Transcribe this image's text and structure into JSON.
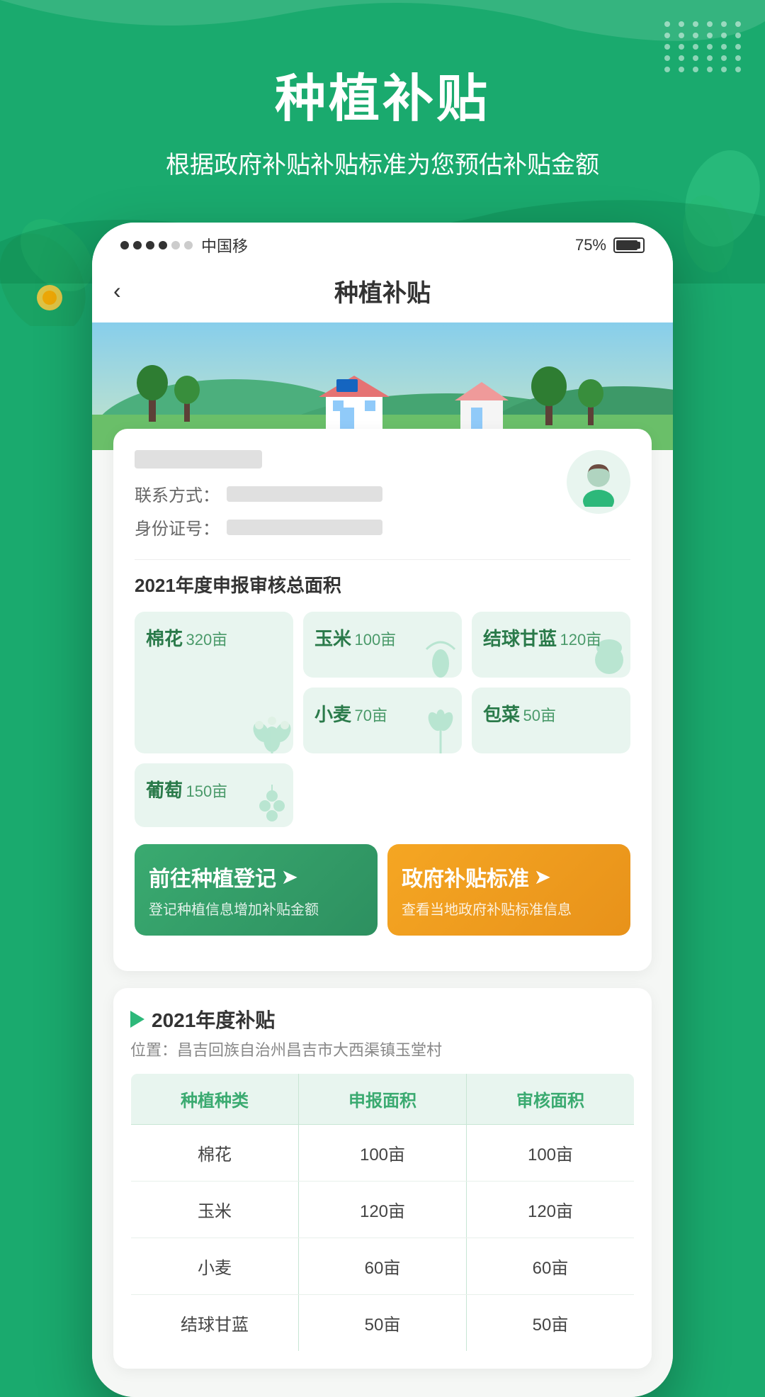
{
  "app": {
    "title": "种植补贴",
    "subtitle": "根据政府补贴补贴标准为您预估补贴金额",
    "status_bar": {
      "carrier": "中国移",
      "battery_percent": "75%",
      "dots": [
        "filled",
        "filled",
        "filled",
        "filled",
        "empty",
        "empty"
      ]
    },
    "back_label": "‹",
    "nav_title": "种植补贴"
  },
  "user": {
    "contact_label": "联系方式：",
    "id_label": "身份证号："
  },
  "crop_section": {
    "title": "2021年度申报审核总面积",
    "crops": [
      {
        "name": "棉花",
        "area": "320亩",
        "tall": true
      },
      {
        "name": "玉米",
        "area": "100亩",
        "tall": false
      },
      {
        "name": "结球甘蓝",
        "area": "120亩",
        "tall": false
      },
      {
        "name": "小麦",
        "area": "70亩",
        "tall": false
      },
      {
        "name": "包菜",
        "area": "50亩",
        "tall": false
      },
      {
        "name": "葡萄",
        "area": "150亩",
        "tall": false
      }
    ]
  },
  "actions": {
    "register": {
      "title": "前往种植登记",
      "arrow": "➤",
      "subtitle": "登记种植信息增加补贴金额"
    },
    "standard": {
      "title": "政府补贴标准",
      "arrow": "➤",
      "subtitle": "查看当地政府补贴标准信息"
    }
  },
  "subsidy": {
    "triangle": "▶",
    "title": "2021年度补贴",
    "location_label": "位置：",
    "location": "昌吉回族自治州昌吉市大西渠镇玉堂村",
    "table": {
      "headers": [
        "种植种类",
        "申报面积",
        "审核面积"
      ],
      "rows": [
        {
          "crop": "棉花",
          "declared": "100亩",
          "approved": "100亩"
        },
        {
          "crop": "玉米",
          "declared": "120亩",
          "approved": "120亩"
        },
        {
          "crop": "小麦",
          "declared": "60亩",
          "approved": "60亩"
        },
        {
          "crop": "结球甘蓝",
          "declared": "50亩",
          "approved": "50亩"
        }
      ]
    }
  }
}
